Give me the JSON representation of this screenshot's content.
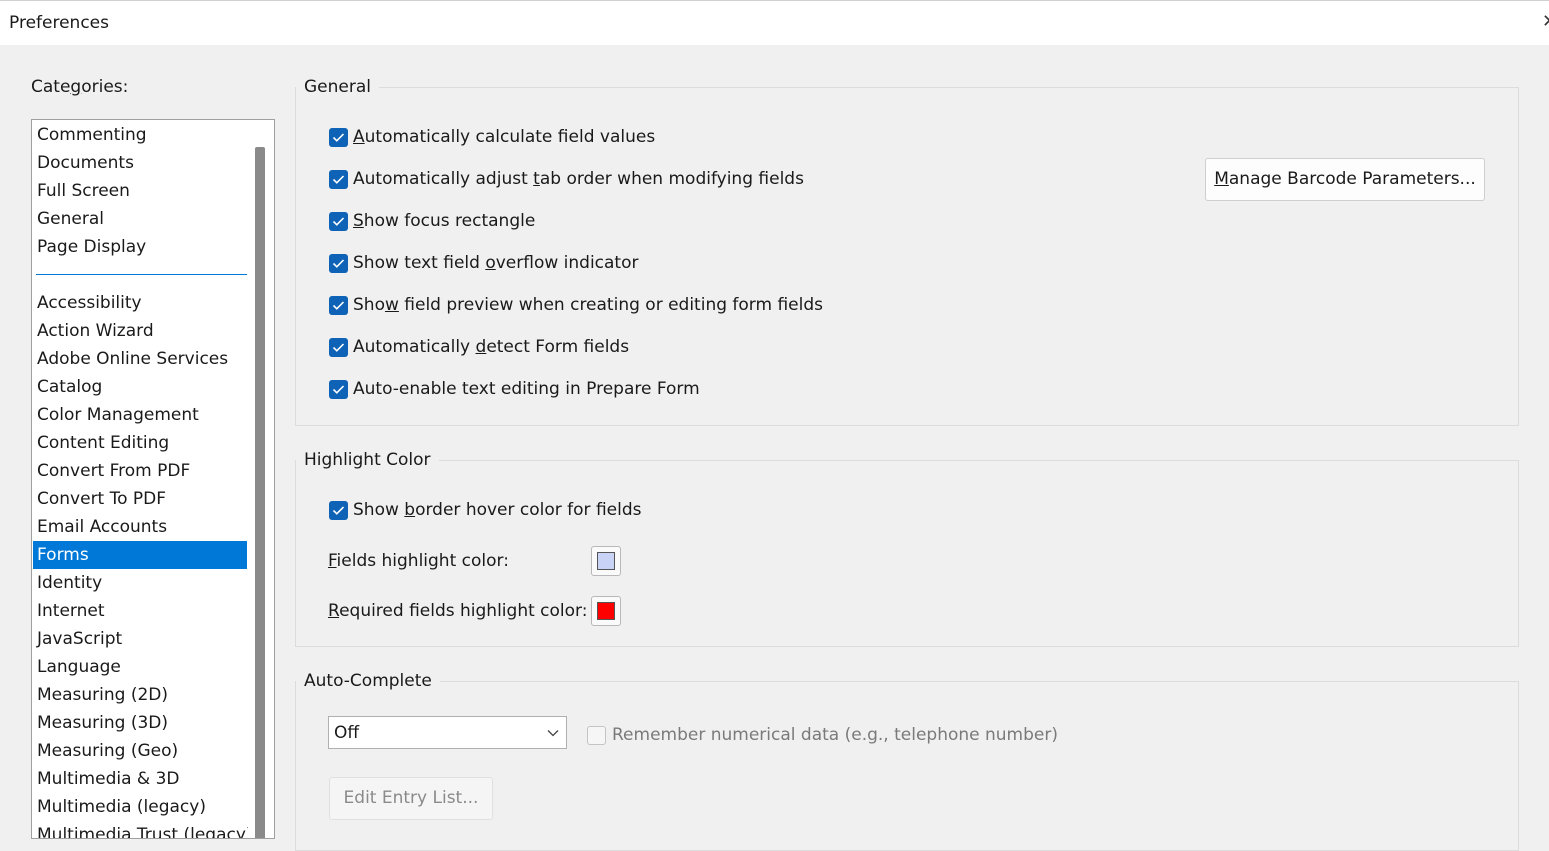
{
  "window": {
    "title": "Preferences",
    "close_glyph": "✕"
  },
  "categories": {
    "label": "Categories:",
    "top_items": [
      {
        "label": "Commenting"
      },
      {
        "label": "Documents"
      },
      {
        "label": "Full Screen"
      },
      {
        "label": "General"
      },
      {
        "label": "Page Display"
      }
    ],
    "items": [
      {
        "label": "Accessibility"
      },
      {
        "label": "Action Wizard"
      },
      {
        "label": "Adobe Online Services"
      },
      {
        "label": "Catalog"
      },
      {
        "label": "Color Management"
      },
      {
        "label": "Content Editing"
      },
      {
        "label": "Convert From PDF"
      },
      {
        "label": "Convert To PDF"
      },
      {
        "label": "Email Accounts"
      },
      {
        "label": "Forms"
      },
      {
        "label": "Identity"
      },
      {
        "label": "Internet"
      },
      {
        "label": "JavaScript"
      },
      {
        "label": "Language"
      },
      {
        "label": "Measuring (2D)"
      },
      {
        "label": "Measuring (3D)"
      },
      {
        "label": "Measuring (Geo)"
      },
      {
        "label": "Multimedia & 3D"
      },
      {
        "label": "Multimedia (legacy)"
      },
      {
        "label": "Multimedia Trust (legacy)"
      }
    ],
    "selected": "Forms",
    "selection_color": "#0078d7"
  },
  "general": {
    "title": "General",
    "options": [
      {
        "pre": "",
        "key": "A",
        "post": "utomatically calculate field values",
        "checked": true
      },
      {
        "pre": "Automatically adjust ",
        "key": "t",
        "post": "ab order when modifying fields",
        "checked": true
      },
      {
        "pre": "",
        "key": "S",
        "post": "how focus rectangle",
        "checked": true
      },
      {
        "pre": "Show text field ",
        "key": "o",
        "post": "verflow indicator",
        "checked": true
      },
      {
        "pre": "Sho",
        "key": "w",
        "post": " field preview when creating or editing form fields",
        "checked": true
      },
      {
        "pre": "Automatically ",
        "key": "d",
        "post": "etect Form fields",
        "checked": true
      },
      {
        "pre": "Auto-enable text editing in Prepare Form",
        "key": "",
        "post": "",
        "checked": true
      }
    ],
    "barcode_button": {
      "pre": "",
      "key": "M",
      "post": "anage Barcode Parameters..."
    }
  },
  "highlight": {
    "title": "Highlight Color",
    "border_hover": {
      "pre": "Show ",
      "key": "b",
      "post": "order hover color for fields",
      "checked": true
    },
    "fields_label": {
      "pre": "",
      "key": "F",
      "post": "ields highlight color:"
    },
    "required_label": {
      "pre": "",
      "key": "R",
      "post": "equired fields highlight color:"
    },
    "fields_color": "#c9d3f5",
    "required_color": "#ff0000"
  },
  "autocomplete": {
    "title": "Auto-Complete",
    "mode": "Off",
    "remember_label": "Remember numerical data (e.g., telephone number)",
    "remember_checked": false,
    "edit_button": "Edit Entry List..."
  }
}
